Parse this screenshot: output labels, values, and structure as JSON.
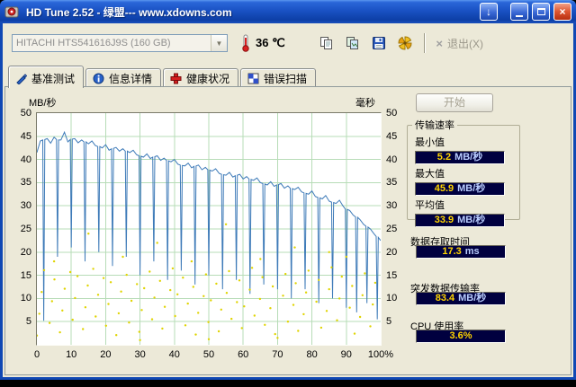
{
  "window": {
    "title": "HD Tune 2.52 - 绿盟--- www.xdowns.com",
    "download_glyph": "↓",
    "close_glyph": "×"
  },
  "toolbar": {
    "drive_select": "HITACHI HTS541616J9S (160 GB)",
    "temperature": "36 ℃",
    "exit_glyph": "×",
    "exit_label": "退出(X)",
    "icons": [
      "copy-text-icon",
      "copy-image-icon",
      "save-icon",
      "options-icon"
    ]
  },
  "tabs": [
    {
      "label": "基准测试",
      "icon": "benchmark-icon",
      "active": true
    },
    {
      "label": "信息详情",
      "icon": "info-icon",
      "active": false
    },
    {
      "label": "健康状况",
      "icon": "health-icon",
      "active": false
    },
    {
      "label": "错误扫描",
      "icon": "scan-icon",
      "active": false
    }
  ],
  "results": {
    "start_button": "开始",
    "transfer_group_title": "传输速率",
    "min_label": "最小值",
    "min_value": "5.2",
    "min_unit": "MB/秒",
    "max_label": "最大值",
    "max_value": "45.9",
    "max_unit": "MB/秒",
    "avg_label": "平均值",
    "avg_value": "33.9",
    "avg_unit": "MB/秒",
    "access_label": "数据存取时间",
    "access_value": "17.3",
    "access_unit": "ms",
    "burst_label": "突发数据传输率",
    "burst_value": "83.4",
    "burst_unit": "MB/秒",
    "cpu_label": "CPU 使用率",
    "cpu_value": "3.6%"
  },
  "chart_data": {
    "type": "line",
    "title": "",
    "y_left_label": "MB/秒",
    "y_right_label": "毫秒",
    "y_range": [
      0,
      50
    ],
    "x_range": [
      0,
      100
    ],
    "y_ticks": [
      50,
      45,
      40,
      35,
      30,
      25,
      20,
      15,
      10,
      5
    ],
    "x_ticks": [
      "0",
      "10",
      "20",
      "30",
      "40",
      "50",
      "60",
      "70",
      "80",
      "90",
      "100%"
    ],
    "grid": true,
    "grid_color": "#b7dcb7",
    "bg_color": "#ffffff",
    "series": [
      {
        "name": "transfer_rate_mb_s",
        "kind": "line",
        "color": "#3d7ab8",
        "points": [
          [
            0,
            41.5
          ],
          [
            1,
            44.0
          ],
          [
            1.7,
            44.2
          ],
          [
            2,
            5.2
          ],
          [
            2.3,
            44.3
          ],
          [
            3,
            44.5
          ],
          [
            4,
            43.5
          ],
          [
            5,
            44.8
          ],
          [
            5.7,
            44.3
          ],
          [
            6,
            19.0
          ],
          [
            6.3,
            44.2
          ],
          [
            7,
            44.2
          ],
          [
            8,
            45.9
          ],
          [
            9,
            43.8
          ],
          [
            9.7,
            44.3
          ],
          [
            10,
            21.0
          ],
          [
            10.3,
            44.4
          ],
          [
            11,
            44.5
          ],
          [
            12,
            43.6
          ],
          [
            13,
            44.2
          ],
          [
            13.7,
            43.8
          ],
          [
            14,
            18.0
          ],
          [
            14.3,
            43.8
          ],
          [
            15,
            43.4
          ],
          [
            16,
            44.0
          ],
          [
            17,
            43.0
          ],
          [
            17.7,
            42.8
          ],
          [
            18,
            20.0
          ],
          [
            18.3,
            42.8
          ],
          [
            19,
            42.5
          ],
          [
            20,
            43.2
          ],
          [
            21,
            42.0
          ],
          [
            21.7,
            42.3
          ],
          [
            22,
            17.0
          ],
          [
            22.3,
            42.4
          ],
          [
            23,
            42.6
          ],
          [
            24,
            41.8
          ],
          [
            25,
            42.3
          ],
          [
            25.7,
            41.8
          ],
          [
            26,
            19.0
          ],
          [
            26.3,
            41.8
          ],
          [
            27,
            41.5
          ],
          [
            28,
            42.0
          ],
          [
            29,
            41.0
          ],
          [
            29.7,
            40.8
          ],
          [
            30,
            15.0
          ],
          [
            30.3,
            40.7
          ],
          [
            31,
            40.5
          ],
          [
            32,
            41.2
          ],
          [
            33,
            40.2
          ],
          [
            33.7,
            40.5
          ],
          [
            34,
            18.0
          ],
          [
            34.3,
            40.6
          ],
          [
            35,
            40.8
          ],
          [
            36,
            39.8
          ],
          [
            37,
            40.3
          ],
          [
            37.7,
            39.8
          ],
          [
            38,
            14.0
          ],
          [
            38.3,
            39.7
          ],
          [
            39,
            39.5
          ],
          [
            40,
            40.0
          ],
          [
            41,
            39.0
          ],
          [
            41.7,
            38.8
          ],
          [
            42,
            16.0
          ],
          [
            42.3,
            38.7
          ],
          [
            43,
            38.6
          ],
          [
            44,
            39.2
          ],
          [
            45,
            38.2
          ],
          [
            45.7,
            38.5
          ],
          [
            46,
            13.0
          ],
          [
            46.3,
            38.6
          ],
          [
            47,
            38.8
          ],
          [
            48,
            37.8
          ],
          [
            49,
            38.3
          ],
          [
            49.7,
            37.8
          ],
          [
            50,
            15.0
          ],
          [
            50.3,
            37.7
          ],
          [
            51,
            37.5
          ],
          [
            52,
            38.0
          ],
          [
            53,
            37.0
          ],
          [
            53.7,
            36.8
          ],
          [
            54,
            12.0
          ],
          [
            54.3,
            36.7
          ],
          [
            55,
            36.6
          ],
          [
            56,
            37.2
          ],
          [
            57,
            36.2
          ],
          [
            57.7,
            36.5
          ],
          [
            58,
            14.0
          ],
          [
            58.3,
            36.6
          ],
          [
            59,
            36.8
          ],
          [
            60,
            35.8
          ],
          [
            61,
            36.3
          ],
          [
            61.7,
            35.8
          ],
          [
            62,
            11.0
          ],
          [
            62.3,
            35.7
          ],
          [
            63,
            35.5
          ],
          [
            64,
            36.0
          ],
          [
            65,
            35.0
          ],
          [
            65.7,
            34.8
          ],
          [
            66,
            13.0
          ],
          [
            66.3,
            34.7
          ],
          [
            67,
            34.5
          ],
          [
            68,
            35.2
          ],
          [
            69,
            34.2
          ],
          [
            69.7,
            34.5
          ],
          [
            70,
            12.0
          ],
          [
            70.3,
            34.6
          ],
          [
            71,
            34.8
          ],
          [
            72,
            33.8
          ],
          [
            73,
            34.3
          ],
          [
            73.7,
            33.8
          ],
          [
            74,
            10.0
          ],
          [
            74.3,
            33.7
          ],
          [
            75,
            33.5
          ],
          [
            76,
            34.0
          ],
          [
            77,
            33.0
          ],
          [
            77.7,
            32.8
          ],
          [
            78,
            12.0
          ],
          [
            78.3,
            32.7
          ],
          [
            79,
            32.5
          ],
          [
            80,
            33.2
          ],
          [
            81,
            32.0
          ],
          [
            81.7,
            31.8
          ],
          [
            82,
            9.0
          ],
          [
            82.3,
            31.7
          ],
          [
            83,
            31.5
          ],
          [
            84,
            32.2
          ],
          [
            85,
            31.0
          ],
          [
            85.7,
            30.8
          ],
          [
            86,
            10.0
          ],
          [
            86.3,
            30.7
          ],
          [
            87,
            30.5
          ],
          [
            88,
            31.2
          ],
          [
            89,
            30.0
          ],
          [
            89.7,
            29.3
          ],
          [
            90,
            8.0
          ],
          [
            90.3,
            29.2
          ],
          [
            91,
            29.0
          ],
          [
            92,
            28.0
          ],
          [
            92.7,
            27.6
          ],
          [
            93,
            7.0
          ],
          [
            93.3,
            27.5
          ],
          [
            94,
            27.0
          ],
          [
            95,
            26.0
          ],
          [
            95.7,
            25.6
          ],
          [
            96,
            9.0
          ],
          [
            96.3,
            25.4
          ],
          [
            97,
            25.0
          ],
          [
            98,
            24.0
          ],
          [
            98.7,
            23.4
          ],
          [
            99,
            5.5
          ],
          [
            99.3,
            23.2
          ],
          [
            100,
            22.5
          ]
        ]
      },
      {
        "name": "access_time_ms",
        "kind": "scatter",
        "color": "#e0d400",
        "points": [
          [
            0,
            2.0
          ],
          [
            9.7,
            15.7
          ],
          [
            19.4,
            14.4
          ],
          [
            29.1,
            13.1
          ],
          [
            38.8,
            11.8
          ],
          [
            48.5,
            10.5
          ],
          [
            58.2,
            9.2
          ],
          [
            67.9,
            7.9
          ],
          [
            77.6,
            6.6
          ],
          [
            87.3,
            5.3
          ],
          [
            97.0,
            4.0
          ],
          [
            6.7,
            2.7
          ],
          [
            16.4,
            16.4
          ],
          [
            26.1,
            15.1
          ],
          [
            35.8,
            13.8
          ],
          [
            45.5,
            12.5
          ],
          [
            55.2,
            11.2
          ],
          [
            64.9,
            9.9
          ],
          [
            74.6,
            8.6
          ],
          [
            84.3,
            7.3
          ],
          [
            94.0,
            6.0
          ],
          [
            3.7,
            4.7
          ],
          [
            13.4,
            3.4
          ],
          [
            23.1,
            2.1
          ],
          [
            32.8,
            15.8
          ],
          [
            42.5,
            14.5
          ],
          [
            52.2,
            13.2
          ],
          [
            61.9,
            11.9
          ],
          [
            71.6,
            10.6
          ],
          [
            81.3,
            9.3
          ],
          [
            91.0,
            8.0
          ],
          [
            0.7,
            6.7
          ],
          [
            10.4,
            5.4
          ],
          [
            20.1,
            4.1
          ],
          [
            29.8,
            2.8
          ],
          [
            39.5,
            16.5
          ],
          [
            49.2,
            15.2
          ],
          [
            58.9,
            13.9
          ],
          [
            68.6,
            12.6
          ],
          [
            78.3,
            11.3
          ],
          [
            88.0,
            10.0
          ],
          [
            97.7,
            8.7
          ],
          [
            7.4,
            7.4
          ],
          [
            17.1,
            6.1
          ],
          [
            26.8,
            4.8
          ],
          [
            36.5,
            3.5
          ],
          [
            46.2,
            2.2
          ],
          [
            55.9,
            15.9
          ],
          [
            65.6,
            14.6
          ],
          [
            75.3,
            13.3
          ],
          [
            85.0,
            12.0
          ],
          [
            94.7,
            10.7
          ],
          [
            4.4,
            9.4
          ],
          [
            14.1,
            8.1
          ],
          [
            23.8,
            6.8
          ],
          [
            33.5,
            5.5
          ],
          [
            43.2,
            4.2
          ],
          [
            52.9,
            2.9
          ],
          [
            62.6,
            16.6
          ],
          [
            72.3,
            15.3
          ],
          [
            82.0,
            14.0
          ],
          [
            91.7,
            12.7
          ],
          [
            1.4,
            11.4
          ],
          [
            11.1,
            10.1
          ],
          [
            20.8,
            8.8
          ],
          [
            30.5,
            7.5
          ],
          [
            40.2,
            6.2
          ],
          [
            49.9,
            4.9
          ],
          [
            59.6,
            3.6
          ],
          [
            69.3,
            2.3
          ],
          [
            79.0,
            16.0
          ],
          [
            88.7,
            14.7
          ],
          [
            98.4,
            13.4
          ],
          [
            8.1,
            12.1
          ],
          [
            17.8,
            10.8
          ],
          [
            27.5,
            9.5
          ],
          [
            37.2,
            8.2
          ],
          [
            46.9,
            6.9
          ],
          [
            56.6,
            5.6
          ],
          [
            66.3,
            4.3
          ],
          [
            76.0,
            3.0
          ],
          [
            85.7,
            16.7
          ],
          [
            95.4,
            15.4
          ],
          [
            5.1,
            14.1
          ],
          [
            14.8,
            12.8
          ],
          [
            24.5,
            11.5
          ],
          [
            34.2,
            10.2
          ],
          [
            43.9,
            8.9
          ],
          [
            53.6,
            7.6
          ],
          [
            63.3,
            6.3
          ],
          [
            73.0,
            5.0
          ],
          [
            82.7,
            3.7
          ],
          [
            92.4,
            2.4
          ],
          [
            2.1,
            16.1
          ],
          [
            11.8,
            14.8
          ],
          [
            21.5,
            13.5
          ],
          [
            31.2,
            12.2
          ],
          [
            40.9,
            10.9
          ],
          [
            50.6,
            9.6
          ],
          [
            60.3,
            8.3
          ],
          [
            15.0,
            24.0
          ],
          [
            35.0,
            22.0
          ],
          [
            55.0,
            26.0
          ],
          [
            75.0,
            21.0
          ],
          [
            90.0,
            19.0
          ],
          [
            25.0,
            19.0
          ],
          [
            45.0,
            18.0
          ],
          [
            65.0,
            18.5
          ],
          [
            85.0,
            20.0
          ],
          [
            5.0,
            18.0
          ],
          [
            50.0,
            1.2
          ],
          [
            30.0,
            1.0
          ],
          [
            70.0,
            1.5
          ]
        ]
      }
    ]
  }
}
